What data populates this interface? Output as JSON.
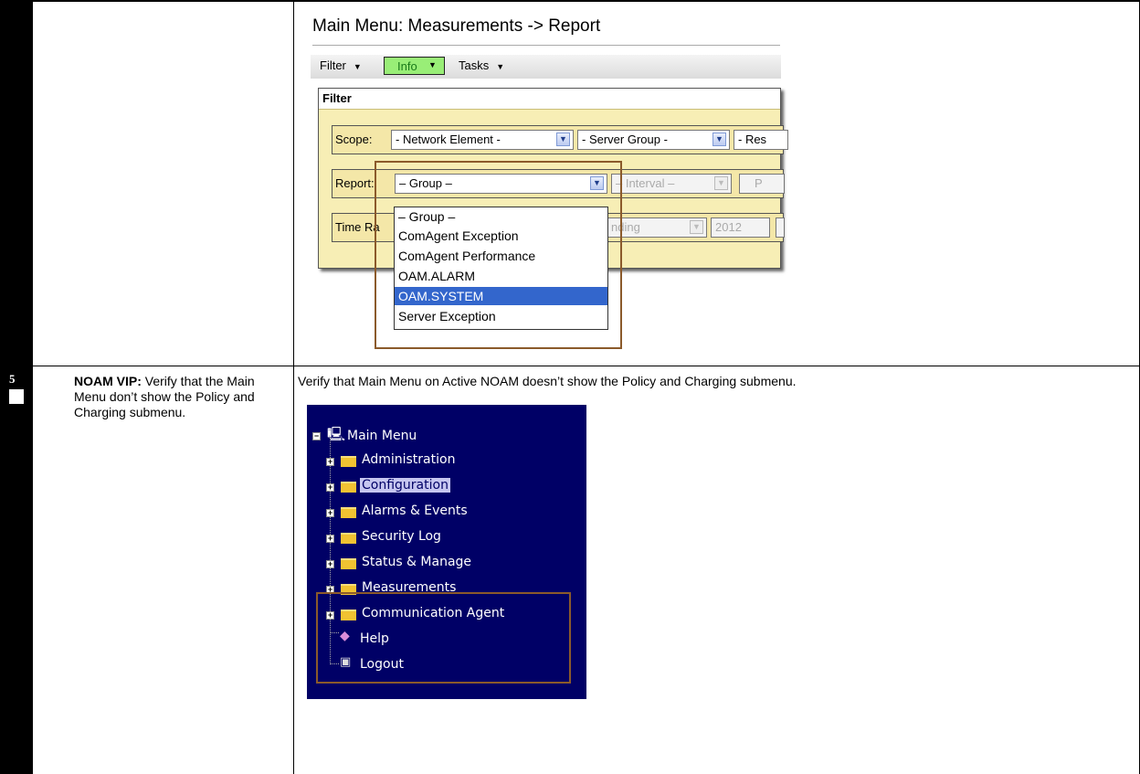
{
  "step": {
    "number": "5",
    "title": "NOAM VIP:",
    "description": " Verify that the Main Menu don’t show the Policy and Charging submenu.",
    "instruction": "Verify that Main Menu on Active NOAM doesn’t show the Policy and Charging submenu."
  },
  "report_screen": {
    "title": "Main Menu: Measurements -> Report",
    "toolbar": {
      "filter": "Filter",
      "info": "Info",
      "tasks": "Tasks"
    },
    "filter_header": "Filter",
    "scope": {
      "label": "Scope:",
      "network_element": "- Network Element -",
      "server_group": "- Server Group -",
      "resource": "- Res"
    },
    "report": {
      "label": "Report:",
      "group_value": "– Group –",
      "interval": "– Interval –",
      "extra": "P"
    },
    "time_range": {
      "label": "Time Ra",
      "ending": "nding",
      "year": "2012"
    },
    "group_options": [
      "– Group –",
      "ComAgent Exception",
      "ComAgent Performance",
      "OAM.ALARM",
      "OAM.SYSTEM",
      "Server Exception"
    ],
    "selected_option": "OAM.SYSTEM"
  },
  "main_menu_tree": {
    "root": "Main Menu",
    "items": [
      "Administration",
      "Configuration",
      "Alarms & Events",
      "Security Log",
      "Status & Manage",
      "Measurements",
      "Communication Agent",
      "Help",
      "Logout"
    ],
    "selected_item": "Configuration"
  },
  "colors": {
    "tree_background": "#000066",
    "info_button": "#99ee77",
    "filter_panel": "#f7eeb5",
    "highlight_box": "#8b5a2b",
    "selected_option": "#3366cc"
  }
}
